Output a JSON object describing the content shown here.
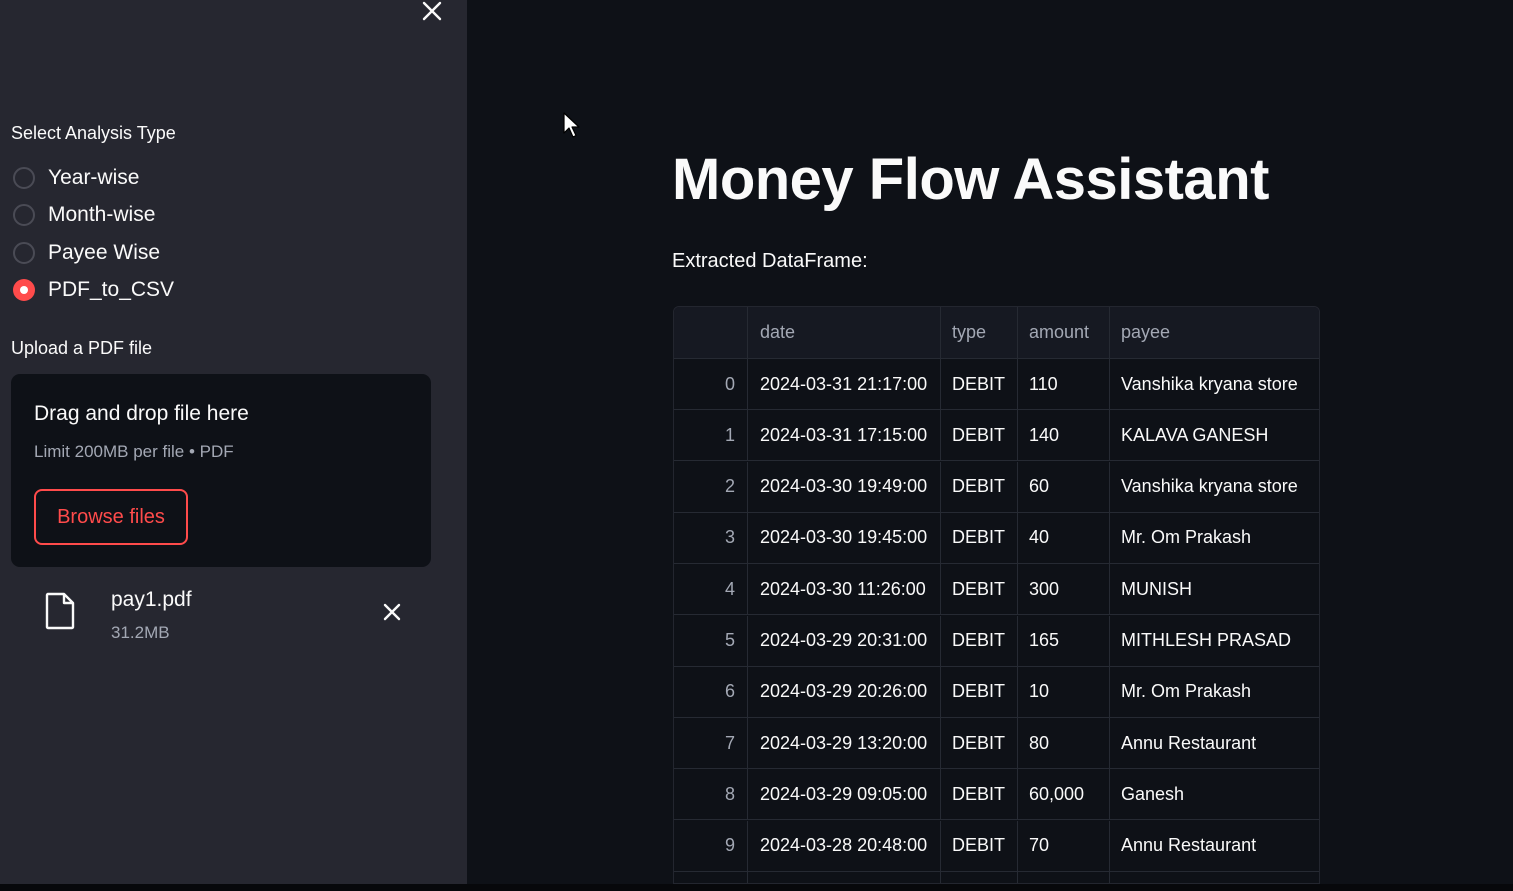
{
  "sidebar": {
    "analysis_label": "Select Analysis Type",
    "options": [
      {
        "label": "Year-wise",
        "checked": false
      },
      {
        "label": "Month-wise",
        "checked": false
      },
      {
        "label": "Payee Wise",
        "checked": false
      },
      {
        "label": "PDF_to_CSV",
        "checked": true
      }
    ],
    "upload_label": "Upload a PDF file",
    "dropzone": {
      "title": "Drag and drop file here",
      "hint": "Limit 200MB per file • PDF",
      "browse_label": "Browse files"
    },
    "uploaded_file": {
      "name": "pay1.pdf",
      "size": "31.2MB"
    }
  },
  "main": {
    "title": "Money Flow Assistant",
    "dataframe_label": "Extracted DataFrame:"
  },
  "table": {
    "headers": {
      "index": "",
      "date": "date",
      "type": "type",
      "amount": "amount",
      "payee": "payee"
    },
    "rows": [
      {
        "index": "0",
        "date": "2024-03-31 21:17:00",
        "type": "DEBIT",
        "amount": "110",
        "payee": "Vanshika kryana store"
      },
      {
        "index": "1",
        "date": "2024-03-31 17:15:00",
        "type": "DEBIT",
        "amount": "140",
        "payee": "KALAVA GANESH"
      },
      {
        "index": "2",
        "date": "2024-03-30 19:49:00",
        "type": "DEBIT",
        "amount": "60",
        "payee": "Vanshika kryana store"
      },
      {
        "index": "3",
        "date": "2024-03-30 19:45:00",
        "type": "DEBIT",
        "amount": "40",
        "payee": "Mr. Om Prakash"
      },
      {
        "index": "4",
        "date": "2024-03-30 11:26:00",
        "type": "DEBIT",
        "amount": "300",
        "payee": "MUNISH"
      },
      {
        "index": "5",
        "date": "2024-03-29 20:31:00",
        "type": "DEBIT",
        "amount": "165",
        "payee": "MITHLESH PRASAD"
      },
      {
        "index": "6",
        "date": "2024-03-29 20:26:00",
        "type": "DEBIT",
        "amount": "10",
        "payee": "Mr. Om Prakash"
      },
      {
        "index": "7",
        "date": "2024-03-29 13:20:00",
        "type": "DEBIT",
        "amount": "80",
        "payee": "Annu Restaurant"
      },
      {
        "index": "8",
        "date": "2024-03-29 09:05:00",
        "type": "DEBIT",
        "amount": "60,000",
        "payee": "Ganesh"
      },
      {
        "index": "9",
        "date": "2024-03-28 20:48:00",
        "type": "DEBIT",
        "amount": "70",
        "payee": "Annu Restaurant"
      },
      {
        "index": "",
        "date": "",
        "type": "",
        "amount": "",
        "payee": ""
      }
    ]
  },
  "colors": {
    "accent": "#ff4b4b",
    "sidebar_bg": "#262730",
    "app_bg": "#0e1117",
    "text": "#fafafa",
    "muted": "#a3a8b4"
  },
  "icons": {
    "sidebar_close": "close-icon",
    "file": "file-icon",
    "file_remove": "close-icon",
    "pointer": "mouse-pointer-icon"
  }
}
